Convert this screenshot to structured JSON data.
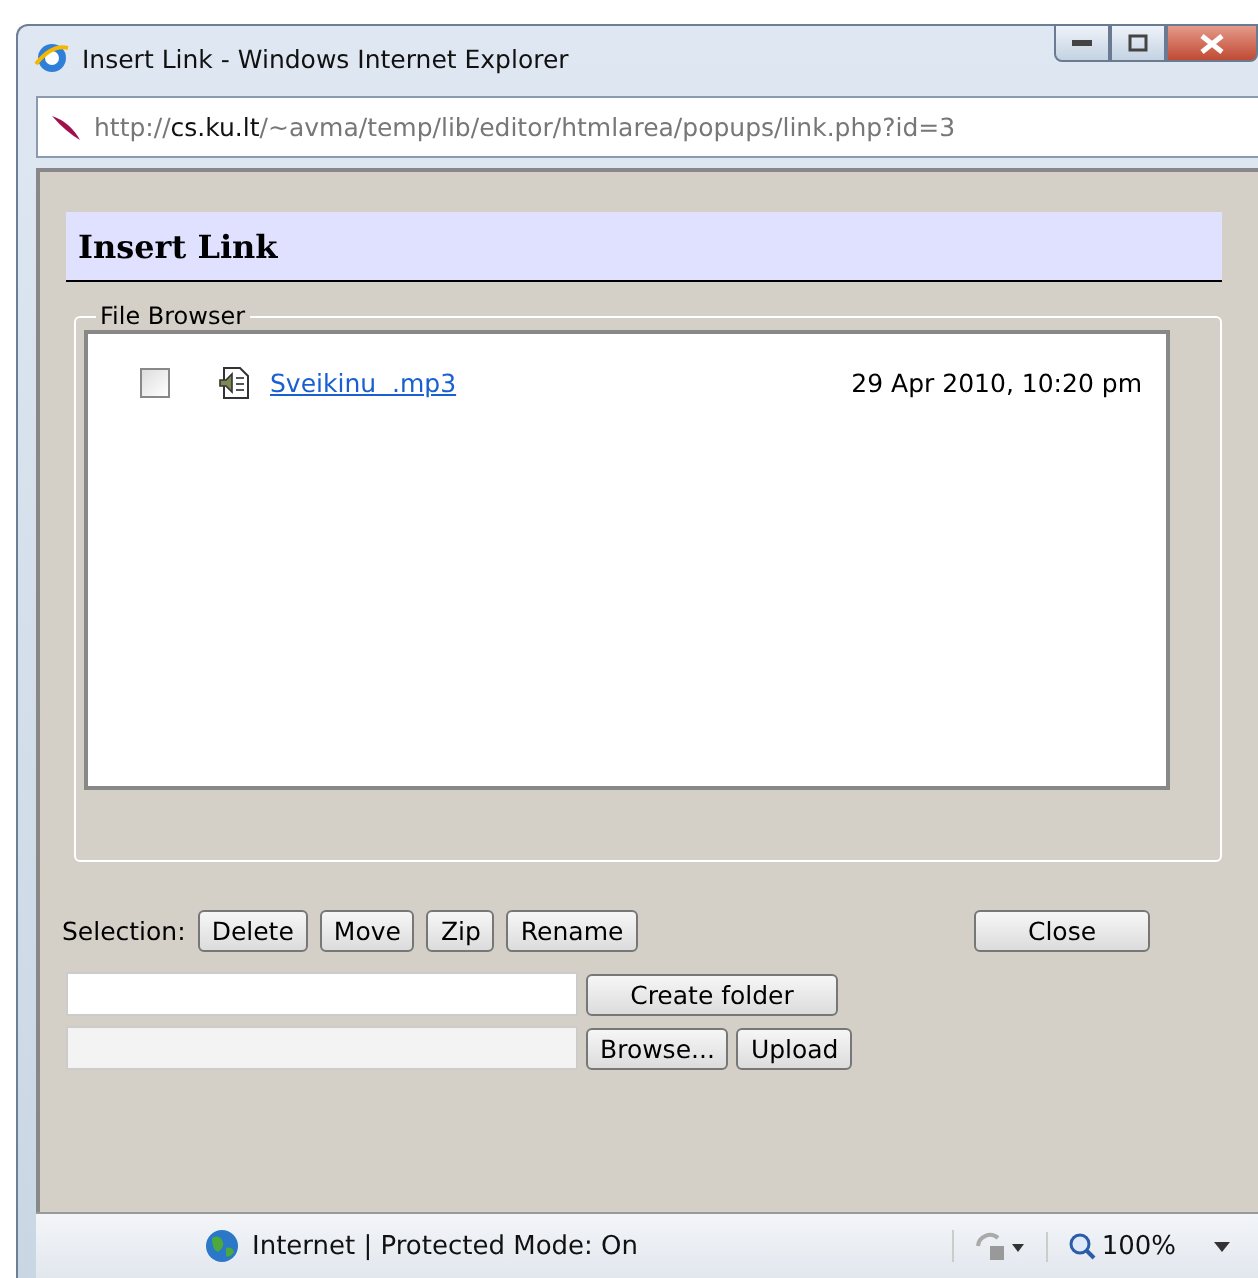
{
  "window": {
    "title": "Insert Link - Windows Internet Explorer"
  },
  "address_bar": {
    "url": "http://**cs.ku.lt**/~avma/temp/lib/editor/htmlarea/popups/link.php?id=3"
  },
  "dialog": {
    "title": "Insert Link"
  },
  "file_browser": {
    "legend": "File Browser",
    "files": [
      {
        "name": "Sveikinu  .mp3",
        "date": "29 Apr 2010, 10:20 pm",
        "checked": false
      }
    ]
  },
  "selection": {
    "label": "Selection:",
    "buttons": [
      "Delete",
      "Move",
      "Zip",
      "Rename"
    ],
    "close": "Close"
  },
  "folder": {
    "button": "Create folder"
  },
  "upload": {
    "browse": "Browse...",
    "button": "Upload"
  },
  "status_bar": {
    "zone": "Internet | Protected Mode: On",
    "zoom": "100%"
  }
}
